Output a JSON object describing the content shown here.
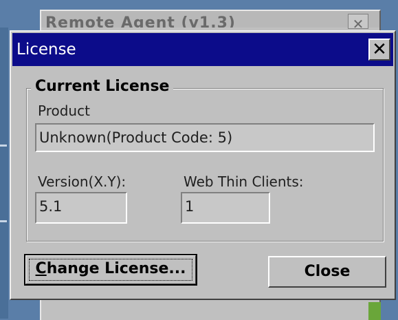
{
  "background_window": {
    "title": "Remote Agent (v1.3)",
    "close_glyph": "✕"
  },
  "dialog": {
    "title": "License",
    "close_glyph": "✕",
    "group": {
      "legend": "Current License",
      "product_label": "Product",
      "product_value": "Unknown(Product Code: 5)",
      "version_label": "Version(X.Y):",
      "version_value": "5.1",
      "clients_label": "Web Thin Clients:",
      "clients_value": "1"
    },
    "buttons": {
      "change_license_first": "C",
      "change_license_rest": "hange License...",
      "close": "Close"
    }
  },
  "colors": {
    "titlebar": "#0c0c8a",
    "desktop": "#5a7ea8",
    "face": "#c0c0c0"
  }
}
